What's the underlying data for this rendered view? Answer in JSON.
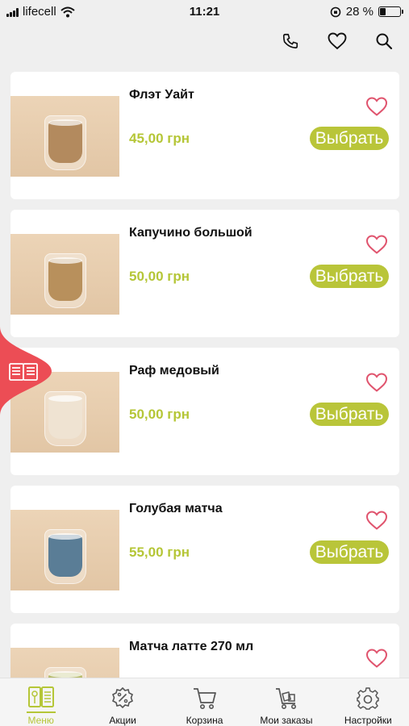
{
  "status_bar": {
    "carrier": "lifecell",
    "time": "11:21",
    "battery": "28 %",
    "battery_level": 0.28
  },
  "header": {
    "icons": [
      "phone-icon",
      "heart-icon",
      "search-icon"
    ]
  },
  "products": [
    {
      "name": "Флэт Уайт",
      "price": "45,00 грн",
      "button": "Выбрать",
      "drink_color": "#b38a5e"
    },
    {
      "name": "Капучино большой",
      "price": "50,00 грн",
      "button": "Выбрать",
      "drink_color": "#b8905c"
    },
    {
      "name": "Раф медовый",
      "price": "50,00 грн",
      "button": "Выбрать",
      "drink_color": "#efe3d2"
    },
    {
      "name": "Голубая матча",
      "price": "55,00 грн",
      "button": "Выбрать",
      "drink_color": "#5a7d96"
    },
    {
      "name": "Матча латте 270 мл",
      "price": "",
      "button": "",
      "drink_color": "#b7bb6a"
    }
  ],
  "tabbar": {
    "items": [
      {
        "label": "Меню",
        "icon": "menu-book-icon",
        "active": true
      },
      {
        "label": "Акции",
        "icon": "discount-icon",
        "active": false
      },
      {
        "label": "Корзина",
        "icon": "cart-icon",
        "active": false
      },
      {
        "label": "Мои заказы",
        "icon": "orders-icon",
        "active": false
      },
      {
        "label": "Настройки",
        "icon": "gear-icon",
        "active": false
      }
    ]
  },
  "colors": {
    "accent": "#b9c539",
    "price": "#b5c637",
    "heart": "#e0546e",
    "side_tab": "#ec4d55"
  }
}
